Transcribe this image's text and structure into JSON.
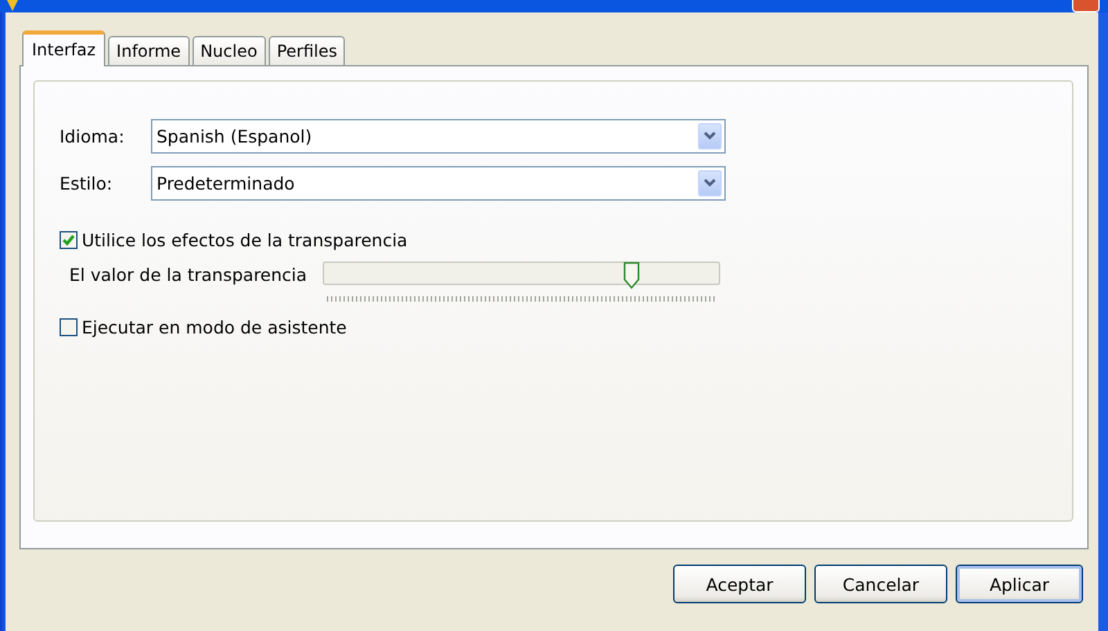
{
  "tabs": [
    {
      "label": "Interfaz",
      "selected": true
    },
    {
      "label": "Informe",
      "selected": false
    },
    {
      "label": "Nucleo",
      "selected": false
    },
    {
      "label": "Perfiles",
      "selected": false
    }
  ],
  "settings": [
    {
      "kind": "dropdown",
      "label": "Idioma:",
      "value": "Spanish (Espanol)"
    },
    {
      "kind": "dropdown",
      "label": "Estilo:",
      "value": "Predeterminado"
    },
    {
      "kind": "checkbox",
      "label": "Utilice los efectos de la transparencia",
      "checked": true
    },
    {
      "kind": "slider",
      "label": "El valor de la transparencia",
      "level": 0.78
    },
    {
      "kind": "checkbox",
      "label": "Ejecutar en modo de asistente",
      "checked": false
    }
  ],
  "buttons": [
    {
      "label": "Aceptar",
      "selected": false
    },
    {
      "label": "Cancelar",
      "selected": false
    },
    {
      "label": "Aplicar",
      "selected": true
    }
  ]
}
